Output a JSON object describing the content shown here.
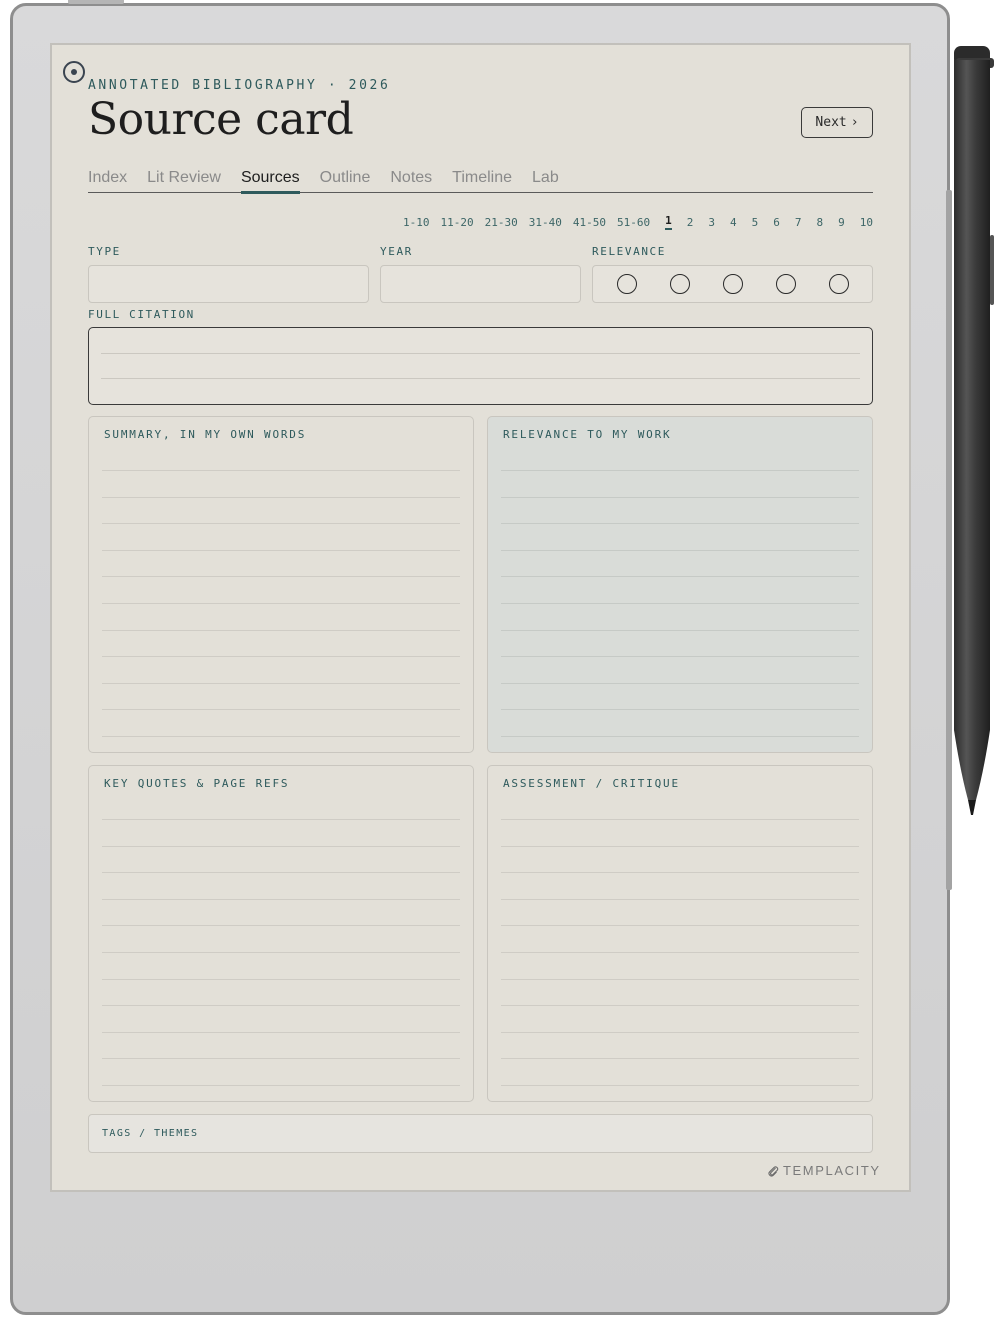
{
  "header": {
    "eyebrow": "ANNOTATED BIBLIOGRAPHY · 2026",
    "title": "Source card",
    "next_label": "Next",
    "next_chevron": "›"
  },
  "tabs": [
    {
      "label": "Index",
      "active": false
    },
    {
      "label": "Lit Review",
      "active": false
    },
    {
      "label": "Sources",
      "active": true
    },
    {
      "label": "Outline",
      "active": false
    },
    {
      "label": "Notes",
      "active": false
    },
    {
      "label": "Timeline",
      "active": false
    },
    {
      "label": "Lab",
      "active": false
    }
  ],
  "pager": {
    "ranges": [
      "1-10",
      "11-20",
      "21-30",
      "31-40",
      "41-50",
      "51-60"
    ],
    "pages": [
      "1",
      "2",
      "3",
      "4",
      "5",
      "6",
      "7",
      "8",
      "9",
      "10"
    ],
    "current": "1"
  },
  "fields": {
    "type_label": "TYPE",
    "year_label": "YEAR",
    "relevance_label": "RELEVANCE",
    "relevance_options": 5,
    "citation_label": "FULL CITATION"
  },
  "panels": {
    "summary": "SUMMARY, IN MY OWN WORDS",
    "relevance": "RELEVANCE TO MY WORK",
    "quotes": "KEY QUOTES & PAGE REFS",
    "assessment": "ASSESSMENT / CRITIQUE"
  },
  "tags_label": "TAGS / THEMES",
  "brand": "TEMPLACITY",
  "colors": {
    "accent": "#2e5a5c",
    "paper": "#e3e0d8",
    "tinted_panel": "#d9dcd8"
  }
}
